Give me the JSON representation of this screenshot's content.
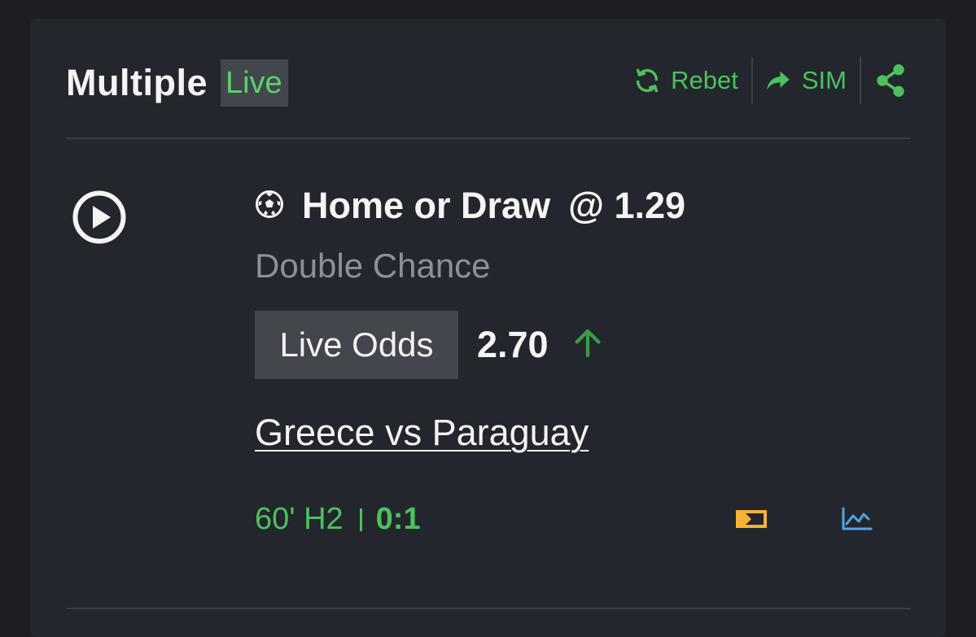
{
  "header": {
    "title": "Multiple",
    "badge": "Live",
    "actions": [
      {
        "label": "Rebet",
        "icon": "refresh-icon"
      },
      {
        "label": "SIM",
        "icon": "forward-arrow-icon"
      },
      {
        "label": "",
        "icon": "share-icon"
      }
    ]
  },
  "selection": {
    "sport_icon": "soccer-ball-icon",
    "name": "Home or Draw",
    "odds": "@ 1.29",
    "market": "Double Chance",
    "live_odds_label": "Live Odds",
    "live_odds_value": "2.70",
    "odds_trend_icon": "arrow-up-icon",
    "match": "Greece vs Paraguay",
    "clock": "60' H2",
    "score": "0:1"
  },
  "icons": {
    "play": "play-icon",
    "live_stream": "tv-stream-icon",
    "stats": "line-chart-icon"
  },
  "colors": {
    "accent_green": "#4cc15c",
    "live_badge_green": "#59d36b",
    "trend_up_green": "#3a9b47",
    "stream_icon": "#f5b335",
    "stats_icon": "#4fa6e6",
    "card_bg": "#23262c",
    "page_bg": "#1c1e23"
  }
}
